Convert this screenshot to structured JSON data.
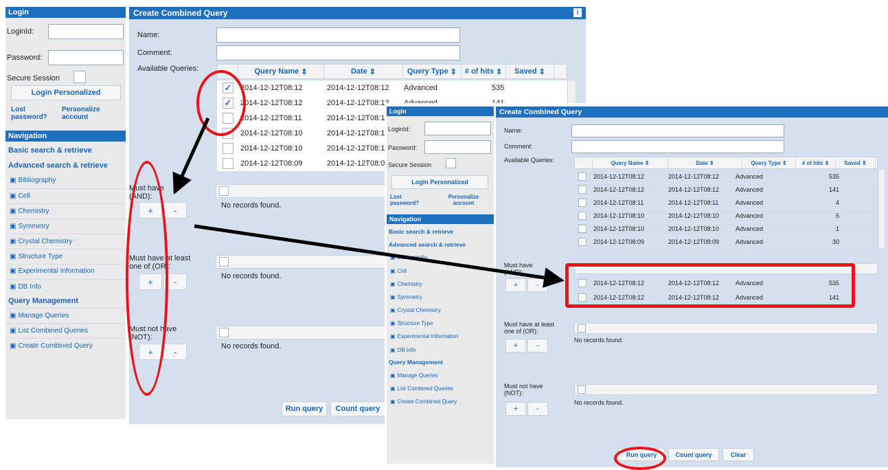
{
  "login": {
    "header": "Login",
    "login_id_label": "LoginId:",
    "password_label": "Password:",
    "secure_session_label": "Secure Session",
    "login_button": "Login Personalized",
    "lost_password": "Lost password?",
    "personalize_account": "Personalize account"
  },
  "navigation": {
    "header": "Navigation",
    "basic": "Basic search & retrieve",
    "advanced": "Advanced search & retrieve",
    "items": [
      "Bibliography",
      "Cell",
      "Chemistry",
      "Symmetry",
      "Crystal Chemistry",
      "Structure Type",
      "Experimental Information",
      "DB Info"
    ],
    "query_management": "Query Management",
    "qm_items": [
      "Manage Queries",
      "List Combined Queries",
      "Create Combined Query"
    ]
  },
  "form": {
    "title": "Create Combined Query",
    "info_icon": "i",
    "name_label": "Name:",
    "comment_label": "Comment:",
    "available_label": "Available Queries:",
    "columns": [
      "Query Name",
      "Date",
      "Query Type",
      "# of hits",
      "Saved"
    ],
    "sort_glyph": "⇕",
    "queries": [
      {
        "name": "2014-12-12T08:12",
        "date": "2014-12-12T08:12",
        "type": "Advanced",
        "hits": "535"
      },
      {
        "name": "2014-12-12T08:12",
        "date": "2014-12-12T08:12",
        "type": "Advanced",
        "hits": "141"
      },
      {
        "name": "2014-12-12T08:11",
        "date": "2014-12-12T08:11",
        "type": "Advanced",
        "hits": "4"
      },
      {
        "name": "2014-12-12T08:10",
        "date": "2014-12-12T08:10",
        "type": "Advanced",
        "hits": "5"
      },
      {
        "name": "2014-12-12T08:10",
        "date": "2014-12-12T08:10",
        "type": "Advanced",
        "hits": "1"
      },
      {
        "name": "2014-12-12T08:09",
        "date": "2014-12-12T08:09",
        "type": "Advanced",
        "hits": "30"
      }
    ],
    "must_have_label": "Must have (AND):",
    "must_have_or_label": "Must have at least one of (OR):",
    "must_not_label": "Must not have (NOT):",
    "plus": "+",
    "minus": "-",
    "no_records": "No records found.",
    "run_query": "Run query",
    "count_query": "Count query",
    "clear": "Clear"
  },
  "annotation_color": "#e8131b"
}
